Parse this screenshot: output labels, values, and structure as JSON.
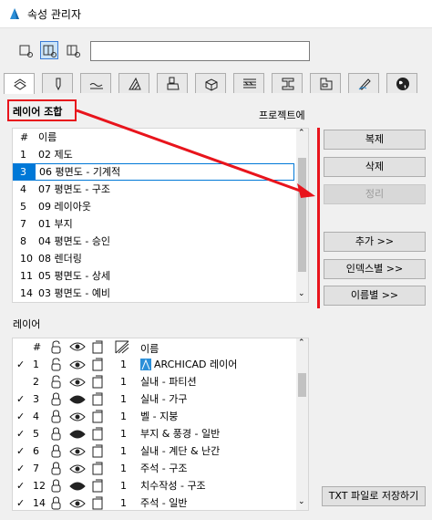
{
  "window": {
    "title": "속성 관리자"
  },
  "search": {
    "value": ""
  },
  "combos": {
    "label": "레이어 조합",
    "project_label": "프로젝트에",
    "columns": {
      "num": "#",
      "name": "이름"
    },
    "rows": [
      {
        "num": "1",
        "name": "02 제도",
        "selected": false
      },
      {
        "num": "3",
        "name": "06 평면도 - 기계적",
        "selected": true
      },
      {
        "num": "4",
        "name": "07 평면도 - 구조",
        "selected": false
      },
      {
        "num": "5",
        "name": "09 레이아웃",
        "selected": false
      },
      {
        "num": "7",
        "name": "01 부지",
        "selected": false
      },
      {
        "num": "8",
        "name": "04 평면도 - 승인",
        "selected": false
      },
      {
        "num": "10",
        "name": "08 렌더링",
        "selected": false
      },
      {
        "num": "11",
        "name": "05 평면도 - 상세",
        "selected": false
      },
      {
        "num": "14",
        "name": "03 평면도 - 예비",
        "selected": false
      }
    ]
  },
  "buttons": {
    "duplicate": "복제",
    "delete": "삭제",
    "clean": "정리",
    "add": "추가 >>",
    "by_index": "인덱스별 >>",
    "by_name": "이름별 >>",
    "save_txt": "TXT 파일로 저장하기"
  },
  "layers": {
    "label": "레이어",
    "columns": {
      "num": "#",
      "num2": "1",
      "name": "이름"
    },
    "rows": [
      {
        "check": "✓",
        "num": "1",
        "pen": "1",
        "name": "ARCHICAD 레이어",
        "has_icon": true,
        "lock_open": true,
        "eye": "open"
      },
      {
        "check": "",
        "num": "2",
        "pen": "1",
        "name": "실내 - 파티션",
        "has_icon": false,
        "lock_open": true,
        "eye": "open"
      },
      {
        "check": "✓",
        "num": "3",
        "pen": "1",
        "name": "실내 - 가구",
        "has_icon": false,
        "lock_open": false,
        "eye": "closed"
      },
      {
        "check": "✓",
        "num": "4",
        "pen": "1",
        "name": "벨 - 지붕",
        "has_icon": false,
        "lock_open": false,
        "eye": "open"
      },
      {
        "check": "✓",
        "num": "5",
        "pen": "1",
        "name": "부지 & 풍경 - 일반",
        "has_icon": false,
        "lock_open": false,
        "eye": "closed"
      },
      {
        "check": "✓",
        "num": "6",
        "pen": "1",
        "name": "실내 - 계단 & 난간",
        "has_icon": false,
        "lock_open": false,
        "eye": "open"
      },
      {
        "check": "✓",
        "num": "7",
        "pen": "1",
        "name": "주석 - 구조",
        "has_icon": false,
        "lock_open": false,
        "eye": "open"
      },
      {
        "check": "✓",
        "num": "12",
        "pen": "1",
        "name": "치수작성 - 구조",
        "has_icon": false,
        "lock_open": false,
        "eye": "closed"
      },
      {
        "check": "✓",
        "num": "14",
        "pen": "1",
        "name": "주석 - 일반",
        "has_icon": false,
        "lock_open": false,
        "eye": "open"
      }
    ]
  },
  "tab_icons": [
    "layers-icon",
    "pen-icon",
    "line-icon",
    "fill-icon",
    "surface-icon",
    "building-material-icon",
    "composite-icon",
    "profile-icon",
    "zone-icon",
    "markup-icon",
    "globe-icon"
  ],
  "colors": {
    "accent": "#e8141c",
    "selection": "#0078d7",
    "archicad": "#2b8fd8"
  }
}
